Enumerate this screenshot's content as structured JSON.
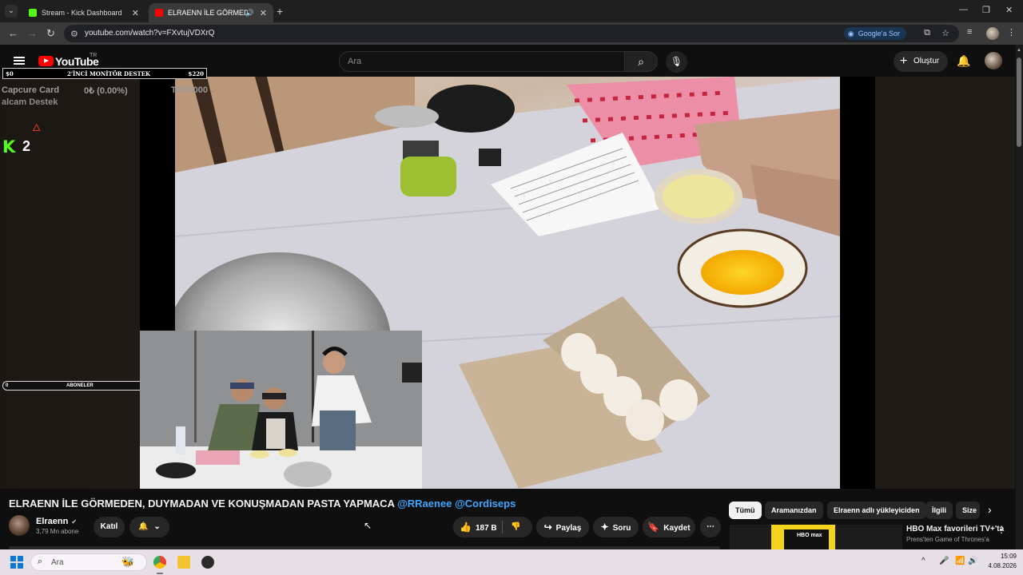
{
  "browser": {
    "tabs": [
      {
        "label": "Stream - Kick Dashboard",
        "favicon_color": "#53fc18"
      },
      {
        "label": "ELRAENN İLE GÖRMEDEN, D",
        "favicon_color": "#ff0000"
      }
    ],
    "url": "youtube.com/watch?v=FXvtujVDXrQ",
    "google_sor_label": "Google'a Sor"
  },
  "youtube": {
    "logo_text": "YouTube",
    "country_code": "TR",
    "search_placeholder": "Ara",
    "create_label": "Oluştur"
  },
  "overlay": {
    "donation_left": "$0",
    "donation_title": "2'İNCİ MONİTÖR DESTEK",
    "donation_right": "$220",
    "capture_label": "Capcure Card",
    "capture_percent": "0₺ (0.00%)",
    "capture_goal": "TRY4000",
    "alcam_label": "alcam Destek",
    "kick_count": "2",
    "subs_left": "0",
    "subs_label": "ABONELER",
    "subs_right": "10"
  },
  "video": {
    "title_main": "ELRAENN İLE GÖRMEDEN, DUYMADAN VE KONUŞMADAN PASTA YAPMACA",
    "mention_1": "@RRaenee",
    "mention_2": "@Cordiseps"
  },
  "channel": {
    "name": "Elraenn",
    "subscribers": "3,79 Mn abone",
    "join_label": "Katıl"
  },
  "actions": {
    "like_count": "187 B",
    "share_label": "Paylaş",
    "ask_label": "Soru",
    "save_label": "Kaydet"
  },
  "chips": [
    "Tümü",
    "Aramanızdan",
    "Elraenn adlı yükleyiciden",
    "İlgili",
    "Size"
  ],
  "ad": {
    "title": "HBO Max favorileri TV+'ta",
    "subtitle": "Prens'ten Game of Thrones'a",
    "logo_text": "HBO max"
  },
  "taskbar": {
    "search_placeholder": "Ara",
    "time": "15:09",
    "date": "4.08.2026"
  },
  "colors": {
    "accent_red": "#ff0000",
    "kick_green": "#53fc18",
    "link_blue": "#3ea6ff"
  }
}
